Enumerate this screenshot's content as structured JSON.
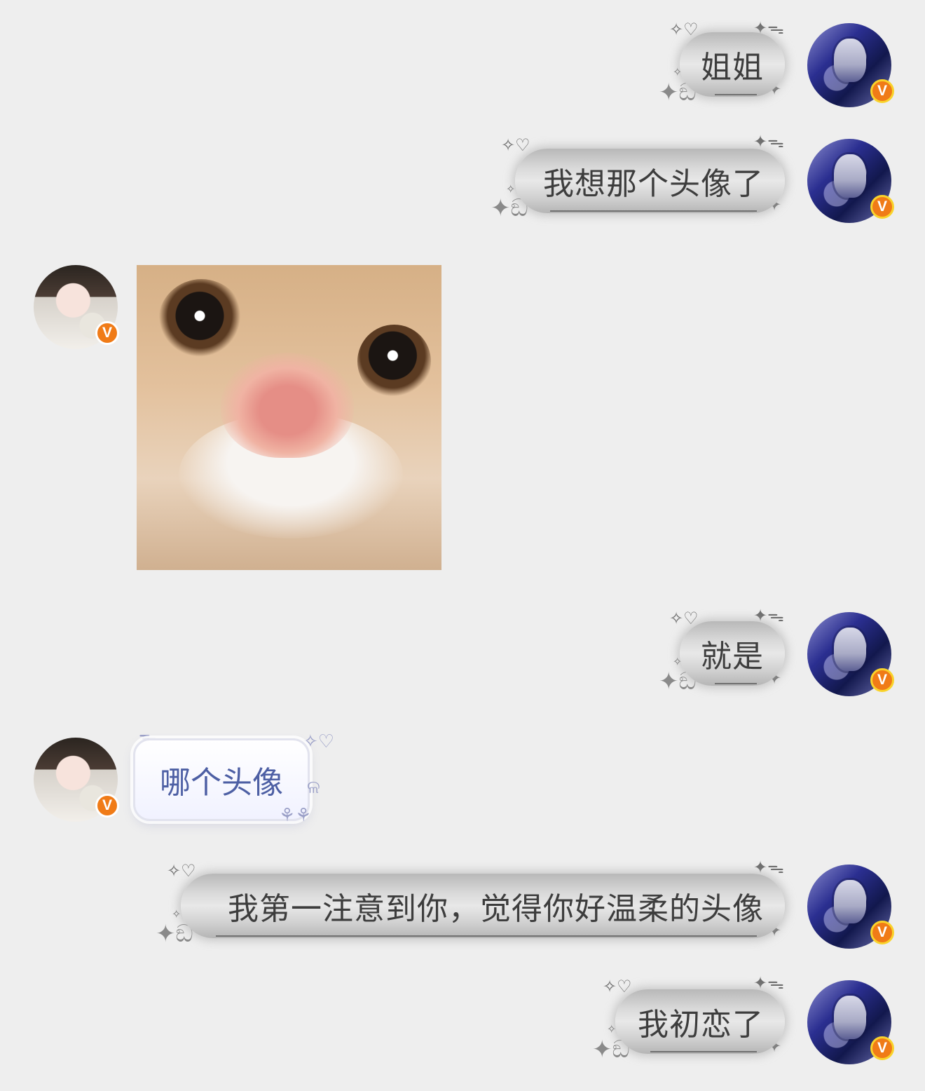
{
  "messages": [
    {
      "id": "m1",
      "side": "me",
      "type": "text",
      "text": "姐姐"
    },
    {
      "id": "m2",
      "side": "me",
      "type": "text",
      "text": "我想那个头像了"
    },
    {
      "id": "m3",
      "side": "peer",
      "type": "image",
      "alt": ""
    },
    {
      "id": "m4",
      "side": "me",
      "type": "text",
      "text": "就是"
    },
    {
      "id": "m5",
      "side": "peer",
      "type": "text",
      "text": "哪个头像"
    },
    {
      "id": "m6",
      "side": "me",
      "type": "text",
      "text": "我第一注意到你，觉得你好温柔的头像"
    },
    {
      "id": "m7",
      "side": "me",
      "type": "text",
      "text": "我初恋了"
    }
  ],
  "verified_badge_letter": "V",
  "colors": {
    "background": "#eeeeee",
    "me_bubble": "#d9d9d9",
    "me_text": "#3d3d3d",
    "peer_bubble": "#f1f2ff",
    "peer_text": "#4d5fa4",
    "badge": "#f07b17"
  }
}
